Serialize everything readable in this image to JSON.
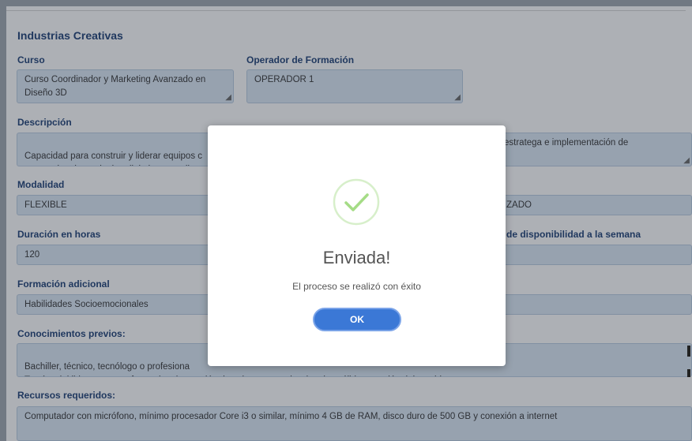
{
  "section_title": "Industrias Creativas",
  "fields": {
    "curso": {
      "label": "Curso",
      "value": "Curso Coordinador y Marketing Avanzado en Diseño 3D"
    },
    "operador": {
      "label": "Operador de Formación",
      "value": "OPERADOR 1"
    },
    "descripcion": {
      "label": "Descripción",
      "value_left": "Capacidad para construir y liderar equipos c\nestrategias de marketing digital personaliza",
      "value_right": "estratega  e implementación de"
    },
    "modalidad": {
      "label": "Modalidad",
      "value": "FLEXIBLE",
      "value_right": "ZADO"
    },
    "duracion": {
      "label": "Duración en horas",
      "value": "120",
      "label_right": "de disponibilidad a la semana"
    },
    "formacion": {
      "label": "Formación adicional",
      "value": "Habilidades Socioemocionales"
    },
    "conocimientos": {
      "label": "Conocimientos previos:",
      "value": "Bachiller, técnico, tecnólogo o profesiona\nTeorías del liderazgo transformacional, creación de culturas organizacionales sólidas, gestión del cambio."
    },
    "recursos": {
      "label": "Recursos requeridos:",
      "value": "Computador con micrófono, mínimo procesador Core i3 o similar, mínimo 4 GB de RAM, disco duro de 500 GB y conexión a internet"
    }
  },
  "modal": {
    "title": "Enviada!",
    "message": "El proceso se realizó con éxito",
    "ok_label": "OK"
  },
  "colors": {
    "accent": "#3b78d6",
    "success": "#a5dc86",
    "label": "#1c3e74",
    "field_bg": "#dce8f6"
  }
}
